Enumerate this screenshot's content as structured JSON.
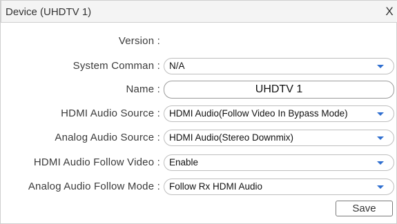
{
  "dialog": {
    "title": "Device (UHDTV 1)",
    "close_label": "X"
  },
  "fields": {
    "version": {
      "label": "Version :"
    },
    "system_command": {
      "label": "System Comman :",
      "value": "N/A"
    },
    "name": {
      "label": "Name :",
      "value": "UHDTV 1"
    },
    "hdmi_audio_source": {
      "label": "HDMI Audio Source :",
      "value": "HDMI Audio(Follow Video In Bypass Mode)"
    },
    "analog_audio_source": {
      "label": "Analog Audio Source :",
      "value": "HDMI Audio(Stereo Downmix)"
    },
    "hdmi_audio_follow_video": {
      "label": "HDMI Audio Follow Video :",
      "value": "Enable"
    },
    "analog_audio_follow_mode": {
      "label": "Analog Audio Follow Mode :",
      "value": "Follow Rx HDMI Audio"
    }
  },
  "buttons": {
    "save_label": "Save"
  },
  "colors": {
    "caret": "#2f6fd0",
    "titlebar": "#f4f4f4"
  }
}
